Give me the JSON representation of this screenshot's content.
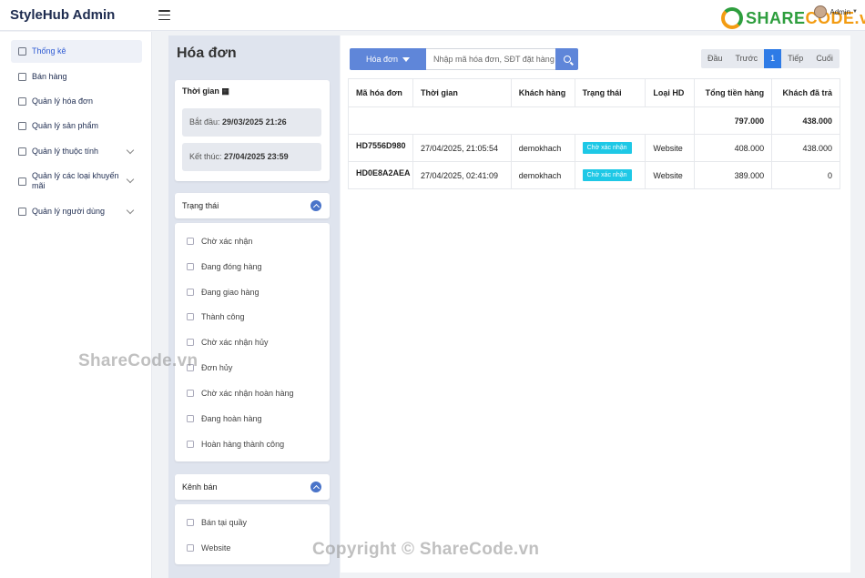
{
  "header": {
    "brand": "StyleHub Admin",
    "logo_part1": "SHARE",
    "logo_part2": "CODE",
    "logo_part3": ".vn",
    "user": "Admin"
  },
  "sidebar": {
    "items": [
      {
        "label": "Thống kê"
      },
      {
        "label": "Bán hàng"
      },
      {
        "label": "Quản lý hóa đơn"
      },
      {
        "label": "Quản lý sản phẩm"
      },
      {
        "label": "Quản lý thuộc tính"
      },
      {
        "label": "Quản lý các loại khuyến mãi"
      },
      {
        "label": "Quản lý người dùng"
      }
    ]
  },
  "filters": {
    "title": "Hóa đơn",
    "time": {
      "title": "Thời gian",
      "start_label": "Bắt đầu:",
      "start_value": "29/03/2025 21:26",
      "end_label": "Kết thúc:",
      "end_value": "27/04/2025 23:59"
    },
    "status": {
      "title": "Trạng thái",
      "options": [
        "Chờ xác nhận",
        "Đang đóng hàng",
        "Đang giao hàng",
        "Thành công",
        "Chờ xác nhận hủy",
        "Đơn hủy",
        "Chờ xác nhận hoàn hàng",
        "Đang hoàn hàng",
        "Hoàn hàng thành công"
      ]
    },
    "channel": {
      "title": "Kênh bán",
      "options": [
        "Bán tại quầy",
        "Website"
      ]
    }
  },
  "search": {
    "dropdown_label": "Hóa đơn",
    "placeholder": "Nhập mã hóa đơn, SĐT đặt hàng"
  },
  "pager": {
    "first": "Đầu",
    "prev": "Trước",
    "current": "1",
    "next": "Tiếp",
    "last": "Cuối"
  },
  "table": {
    "headers": [
      "Mã hóa đơn",
      "Thời gian",
      "Khách hàng",
      "Trạng thái",
      "Loại HD",
      "Tổng tiền hàng",
      "Khách đã trả"
    ],
    "summary": {
      "total": "797.000",
      "paid": "438.000"
    },
    "rows": [
      {
        "code": "HD7556D980",
        "time": "27/04/2025, 21:05:54",
        "customer": "demokhach",
        "status": "Chờ xác nhận",
        "type": "Website",
        "total": "408.000",
        "paid": "438.000"
      },
      {
        "code": "HD0E8A2AEA",
        "time": "27/04/2025, 02:41:09",
        "customer": "demokhach",
        "status": "Chờ xác nhận",
        "type": "Website",
        "total": "389.000",
        "paid": "0"
      }
    ]
  },
  "watermarks": {
    "side": "ShareCode.vn",
    "bottom": "Copyright © ShareCode.vn"
  }
}
